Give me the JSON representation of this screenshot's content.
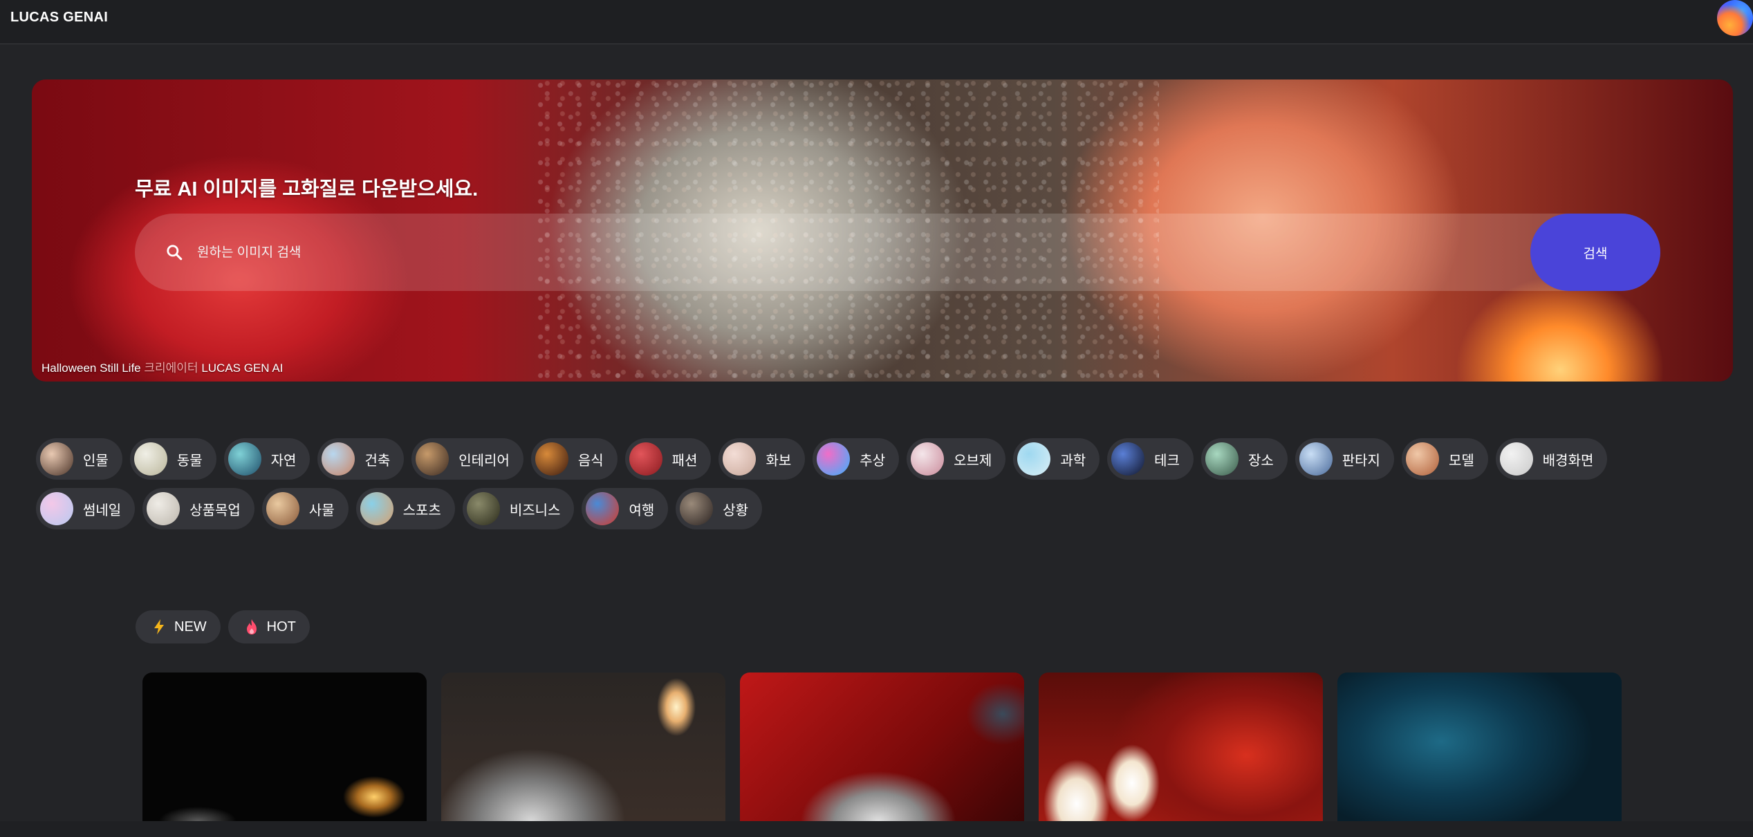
{
  "header": {
    "brand": "LUCAS GENAI",
    "avatar_icon": "profile-avatar"
  },
  "hero": {
    "title": "무료 AI 이미지를 고화질로 다운받으세요.",
    "search": {
      "placeholder": "원하는 이미지 검색",
      "button_label": "검색"
    },
    "credit": {
      "image_title": "Halloween Still Life",
      "creator_label": "크리에이터",
      "creator_name": "LUCAS GEN AI"
    }
  },
  "categories": {
    "row1": [
      {
        "label": "인물",
        "colors": [
          "#e9c9b2",
          "#4a3328"
        ]
      },
      {
        "label": "동물",
        "colors": [
          "#f0efe6",
          "#b9b59a"
        ]
      },
      {
        "label": "자연",
        "colors": [
          "#7fd1d6",
          "#1f4e6a"
        ]
      },
      {
        "label": "건축",
        "colors": [
          "#b8d7ef",
          "#c88466"
        ]
      },
      {
        "label": "인테리어",
        "colors": [
          "#c79a6a",
          "#3a2a22"
        ]
      },
      {
        "label": "음식",
        "colors": [
          "#d88a3a",
          "#3a1a10"
        ]
      },
      {
        "label": "패션",
        "colors": [
          "#e2555a",
          "#8a1a1f"
        ]
      },
      {
        "label": "화보",
        "colors": [
          "#f3ddd6",
          "#c9a89a"
        ]
      },
      {
        "label": "추상",
        "colors": [
          "#f06ec8",
          "#3ab0ff"
        ]
      },
      {
        "label": "오브제",
        "colors": [
          "#f4e6ea",
          "#c98a9a"
        ]
      },
      {
        "label": "과학",
        "colors": [
          "#9ed8f0",
          "#d9eef5"
        ]
      },
      {
        "label": "테크",
        "colors": [
          "#5a7fd6",
          "#10152a"
        ]
      },
      {
        "label": "장소",
        "colors": [
          "#a8d8c0",
          "#3a5a4a"
        ]
      },
      {
        "label": "판타지",
        "colors": [
          "#c9def5",
          "#4a6a9a"
        ]
      },
      {
        "label": "모델",
        "colors": [
          "#f0c8a8",
          "#b0603a"
        ]
      },
      {
        "label": "배경화면",
        "colors": [
          "#f2f2f2",
          "#c9c9c9"
        ]
      }
    ],
    "row2": [
      {
        "label": "썸네일",
        "colors": [
          "#f3c8e8",
          "#b9c9f0"
        ]
      },
      {
        "label": "상품목업",
        "colors": [
          "#efece6",
          "#bcb6ac"
        ]
      },
      {
        "label": "사물",
        "colors": [
          "#e9c9a0",
          "#8a5a3a"
        ]
      },
      {
        "label": "스포츠",
        "colors": [
          "#8ad0e8",
          "#d6a070"
        ]
      },
      {
        "label": "비즈니스",
        "colors": [
          "#8a8a6a",
          "#2a2a1a"
        ]
      },
      {
        "label": "여행",
        "colors": [
          "#4a8ad6",
          "#d63a2a"
        ]
      },
      {
        "label": "상황",
        "colors": [
          "#9a8a7a",
          "#2a2220"
        ]
      }
    ]
  },
  "feed_tabs": [
    {
      "label": "NEW",
      "icon": "lightning-icon",
      "color": "#f5b51b"
    },
    {
      "label": "HOT",
      "icon": "flame-icon",
      "color": "#ff4d6d"
    }
  ],
  "gallery": [
    {
      "name": "candle-dark"
    },
    {
      "name": "sequin-egg-candle"
    },
    {
      "name": "red-velvet-skull"
    },
    {
      "name": "candles-red"
    },
    {
      "name": "blue-smoke"
    }
  ]
}
